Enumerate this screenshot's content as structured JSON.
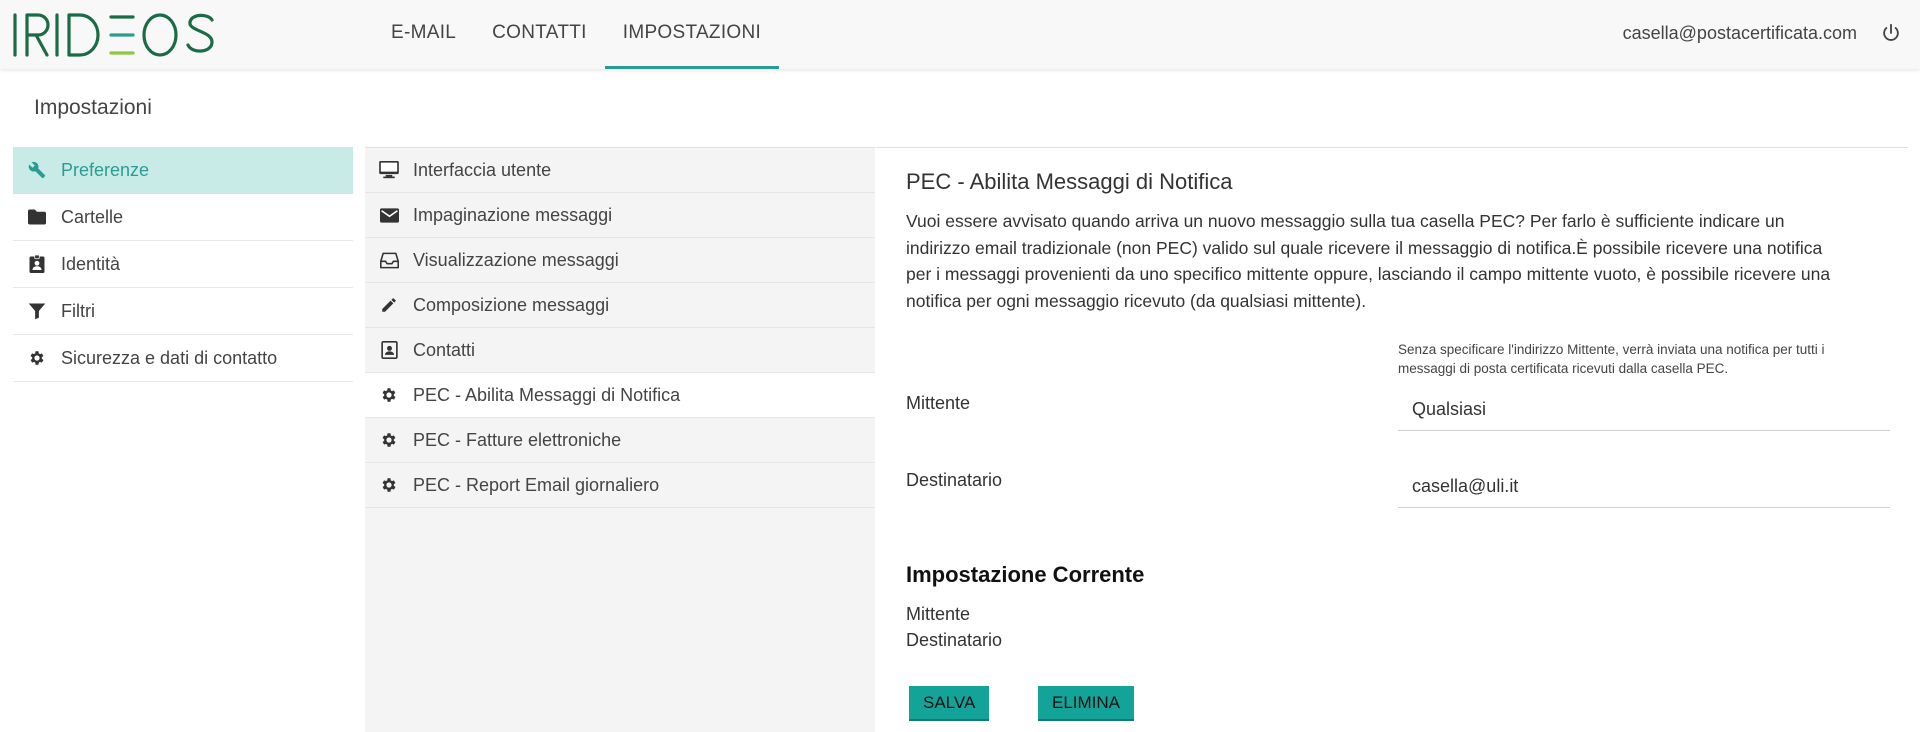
{
  "header": {
    "logo_text": "IRIDEOS",
    "tabs": [
      {
        "label": "E-MAIL"
      },
      {
        "label": "CONTATTI"
      },
      {
        "label": "IMPOSTAZIONI",
        "active": true
      }
    ],
    "user_email": "casella@postacertificata.com",
    "logout_icon": "power-icon"
  },
  "page_title": "Impostazioni",
  "sidebar": {
    "items": [
      {
        "label": "Preferenze",
        "icon": "wrench-icon",
        "active": true
      },
      {
        "label": "Cartelle",
        "icon": "folder-icon"
      },
      {
        "label": "Identità",
        "icon": "id-badge-icon"
      },
      {
        "label": "Filtri",
        "icon": "filter-icon"
      },
      {
        "label": "Sicurezza e dati di contatto",
        "icon": "gear-icon"
      }
    ]
  },
  "submenu": {
    "items": [
      {
        "label": "Interfaccia utente",
        "icon": "monitor-icon"
      },
      {
        "label": "Impaginazione messaggi",
        "icon": "envelope-icon"
      },
      {
        "label": "Visualizzazione messaggi",
        "icon": "inbox-icon"
      },
      {
        "label": "Composizione messaggi",
        "icon": "pencil-icon"
      },
      {
        "label": "Contatti",
        "icon": "contact-card-icon"
      },
      {
        "label": "PEC - Abilita Messaggi di Notifica",
        "icon": "gear-icon",
        "active": true
      },
      {
        "label": "PEC - Fatture elettroniche",
        "icon": "gear-icon"
      },
      {
        "label": "PEC - Report Email giornaliero",
        "icon": "gear-icon"
      }
    ]
  },
  "content": {
    "title": "PEC - Abilita Messaggi di Notifica",
    "description": "Vuoi essere avvisato quando arriva un nuovo messaggio sulla tua casella PEC? Per farlo è sufficiente indicare un indirizzo email tradizionale (non PEC) valido sul quale ricevere il messaggio di notifica.È possibile ricevere una notifica per i messaggi provenienti da uno specifico mittente oppure, lasciando il campo mittente vuoto, è possibile ricevere una notifica per ogni messaggio ricevuto (da qualsiasi mittente).",
    "hint": "Senza specificare l'indirizzo Mittente, verrà  inviata una notifica per tutti i messaggi di posta certificata ricevuti dalla casella PEC.",
    "mittente_label": "Mittente",
    "mittente_value": "Qualsiasi",
    "destinatario_label": "Destinatario",
    "destinatario_value": "casella@uli.it",
    "current_title": "Impostazione Corrente",
    "current_mittente": "Mittente",
    "current_destinatario": "Destinatario",
    "save_label": "SALVA",
    "delete_label": "ELIMINA"
  },
  "colors": {
    "accent": "#2a9d93",
    "button": "#13a398",
    "active_bg": "#c9ebe8",
    "logo": "#1a6b46"
  }
}
